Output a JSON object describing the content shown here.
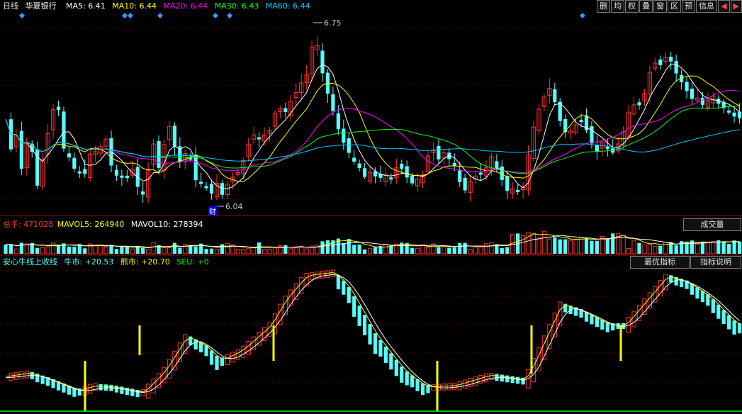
{
  "domain_hint": "Computer-Use",
  "top": {
    "period": "日线",
    "stock": "华夏银行",
    "ma": [
      {
        "label": "MA5:",
        "value": "6.41",
        "color": "#ffffff"
      },
      {
        "label": "MA10:",
        "value": "6.44",
        "color": "#ffff00"
      },
      {
        "label": "MA20:",
        "value": "6.44",
        "color": "#ff00ff"
      },
      {
        "label": "MA30:",
        "value": "6.43",
        "color": "#00ff00"
      },
      {
        "label": "MA60:",
        "value": "6.44",
        "color": "#00ccff"
      }
    ],
    "high_label": "6.75",
    "low_label": "6.04",
    "event_label": "财",
    "buttons": [
      "删",
      "均",
      "权",
      "叠",
      "窗",
      "区",
      "预",
      "信息"
    ],
    "arrows": [
      "◀",
      "▶"
    ]
  },
  "volume": {
    "total_label": "总手:",
    "total_value": "471028",
    "mavol5_label": "MAVOL5:",
    "mavol5_value": "264940",
    "mavol10_label": "MAVOL10:",
    "mavol10_value": "278394",
    "selector": "成交量"
  },
  "indicator": {
    "title": "安心牛线上收线",
    "bull_label": "牛市:",
    "bull_value": "+20.53",
    "bear_label": "熊市:",
    "bear_value": "+20.70",
    "seu_label": "SEU:",
    "seu_value": "+0",
    "btn_best": "最优指标",
    "btn_desc": "指标说明"
  },
  "colors": {
    "up": "#ff3232",
    "down": "#54ffff",
    "grid": "#7a0000",
    "signal": "#ffff00"
  }
}
